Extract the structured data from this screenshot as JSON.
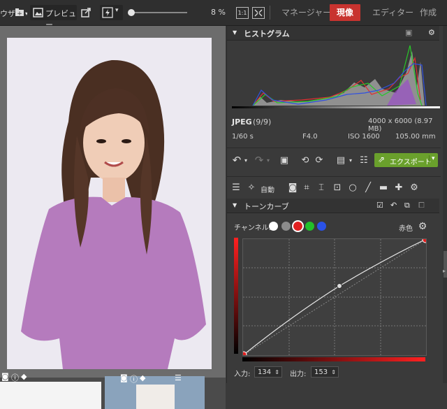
{
  "toolbar": {
    "browser_fragment": "ウザ",
    "preview_label": "プレビュー",
    "zoom_percent": "8 %",
    "zoom_value": 0.05,
    "one_to_one": "1:1"
  },
  "modules": [
    {
      "label": "マネージャー",
      "active": false
    },
    {
      "label": "現像",
      "active": true
    },
    {
      "label": "エディター",
      "active": false
    },
    {
      "label": "作成",
      "active": false
    }
  ],
  "histogram": {
    "title": "ヒストグラム",
    "format": "JPEG",
    "index": "(9/9)",
    "dimensions": "4000 x 6000 (8.97 MB)",
    "shutter": "1/60 s",
    "aperture": "F4.0",
    "iso": "ISO 1600",
    "focal": "105.00 mm"
  },
  "actions": {
    "export_label": "エクスポート",
    "auto_label": "自動"
  },
  "tone_curve": {
    "title": "トーンカーブ",
    "channel_label": "チャンネル:",
    "current_channel": "赤色",
    "input_label": "入力:",
    "input_value": "134",
    "output_label": "出力:",
    "output_value": "153"
  },
  "colors": {
    "accent_red": "#c8332f",
    "export_green": "#6aa02c",
    "channel_red": "#e02020",
    "channel_green": "#22c02a",
    "channel_blue": "#2a52e8"
  }
}
